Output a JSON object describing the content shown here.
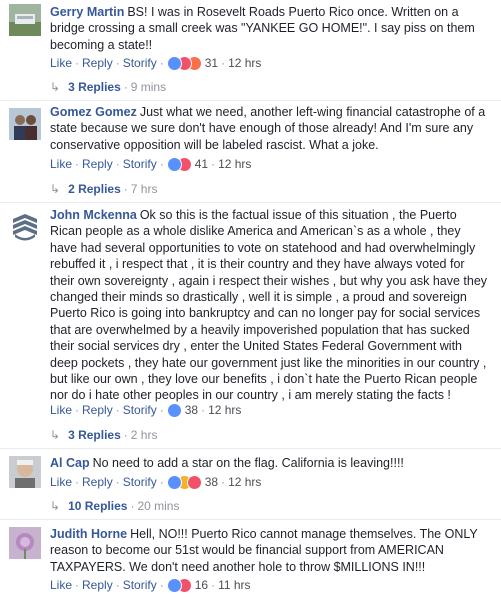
{
  "comments": [
    {
      "author": "Gerry Martin",
      "text": "BS! I was in Rosevelt Roads Puerto Rico once. Written on a bridge crossing a small creek was \"YANKEE GO HOME!\". I say piss on them becoming a state!!",
      "actions": {
        "like": "Like",
        "reply": "Reply",
        "storify": "Storify"
      },
      "reactions": [
        "like",
        "love",
        "angry"
      ],
      "reaction_count": "31",
      "time": "12 hrs",
      "replies": {
        "label": "3 Replies",
        "time": "9 mins"
      }
    },
    {
      "author": "Gomez Gomez",
      "text": "Just what we need, another left-wing financial catastrophe of a state because we sure don't have enough of those already! And I'm sure any conservative opposition will be labeled rascist. What a joke.",
      "actions": {
        "like": "Like",
        "reply": "Reply",
        "storify": "Storify"
      },
      "reactions": [
        "like",
        "love"
      ],
      "reaction_count": "41",
      "time": "12 hrs",
      "replies": {
        "label": "2 Replies",
        "time": "7 hrs"
      }
    },
    {
      "author": "John Mckenna",
      "text": "Ok so this is the factual issue of this situation , the Puerto Rican people as a whole dislike America and American`s as a whole , they have had several opportunities to vote on statehood and had overwhelmingly rebuffed it , i respect that , it is their country and they have always voted for their own sovereignty , again i respect their wishes , but why you ask have they changed their minds so drastically , well it is simple , a proud and sovereign Puerto Rico is going into bankruptcy and can no longer pay for social services that are overwhelmed by a heavily impoverished population that has sucked their social services dry , enter the United States Federal Government with deep pockets , they hate our government just like the minorities in our country , but like our own , they love our benefits , i don`t hate the Puerto Rican people nor do i hate other peoples in our country , i am merely stating the facts !",
      "actions": {
        "like": "Like",
        "reply": "Reply",
        "storify": "Storify"
      },
      "reactions": [
        "like"
      ],
      "reaction_count": "38",
      "time": "12 hrs",
      "replies": {
        "label": "3 Replies",
        "time": "2 hrs"
      }
    },
    {
      "author": "Al Cap",
      "text": "No need to add a star on the flag. California is leaving!!!!",
      "actions": {
        "like": "Like",
        "reply": "Reply",
        "storify": "Storify"
      },
      "reactions": [
        "like",
        "haha",
        "love"
      ],
      "reaction_count": "38",
      "time": "12 hrs",
      "replies": {
        "label": "10 Replies",
        "time": "20 mins"
      }
    },
    {
      "author": "Judith Horne",
      "text": "Hell, NO!!! Puerto Rico cannot manage themselves. The ONLY reason to become our 51st would be financial support from AMERICAN TAXPAYERS. We don't need another hole to throw $MILLIONS IN!!!",
      "actions": {
        "like": "Like",
        "reply": "Reply",
        "storify": "Storify"
      },
      "reactions": [
        "like",
        "love"
      ],
      "reaction_count": "16",
      "time": "11 hrs"
    }
  ],
  "separator": "·",
  "reply_arrow": "↳",
  "colors": {
    "link": "#365899",
    "like": "#5890ff",
    "love": "#f25268",
    "angry": "#f7714b",
    "haha": "#f7b125"
  }
}
